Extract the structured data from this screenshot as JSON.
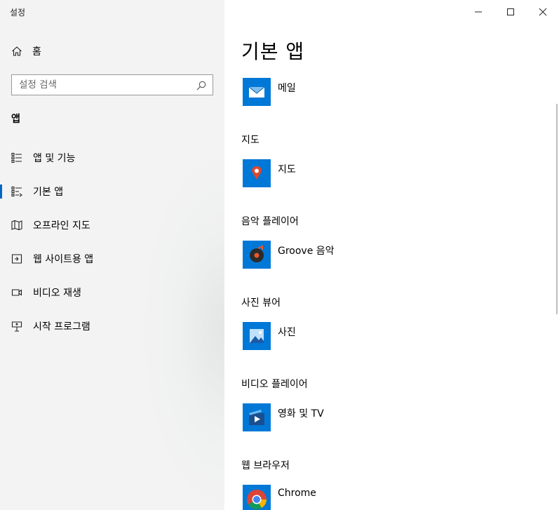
{
  "window": {
    "title": "설정"
  },
  "sidebar": {
    "home_label": "홈",
    "search_placeholder": "설정 검색",
    "section_label": "앱",
    "items": [
      {
        "label": "앱 및 기능",
        "icon": "list-icon",
        "selected": false
      },
      {
        "label": "기본 앱",
        "icon": "default-apps-icon",
        "selected": true
      },
      {
        "label": "오프라인 지도",
        "icon": "map-icon",
        "selected": false
      },
      {
        "label": "웹 사이트용 앱",
        "icon": "link-out-icon",
        "selected": false
      },
      {
        "label": "비디오 재생",
        "icon": "video-icon",
        "selected": false
      },
      {
        "label": "시작 프로그램",
        "icon": "startup-icon",
        "selected": false
      }
    ]
  },
  "main": {
    "title": "기본 앱",
    "groups": [
      {
        "heading": "",
        "app": "메일",
        "icon": "mail-icon"
      },
      {
        "heading": "지도",
        "app": "지도",
        "icon": "maps-pin-icon"
      },
      {
        "heading": "음악 플레이어",
        "app": "Groove 음악",
        "icon": "groove-music-icon"
      },
      {
        "heading": "사진 뷰어",
        "app": "사진",
        "icon": "photos-icon"
      },
      {
        "heading": "비디오 플레이어",
        "app": "영화 및 TV",
        "icon": "movies-tv-icon"
      },
      {
        "heading": "웹 브라우저",
        "app": "Chrome",
        "icon": "chrome-icon"
      }
    ]
  },
  "colors": {
    "accent": "#0067c0",
    "tile_blue": "#0078d7"
  }
}
